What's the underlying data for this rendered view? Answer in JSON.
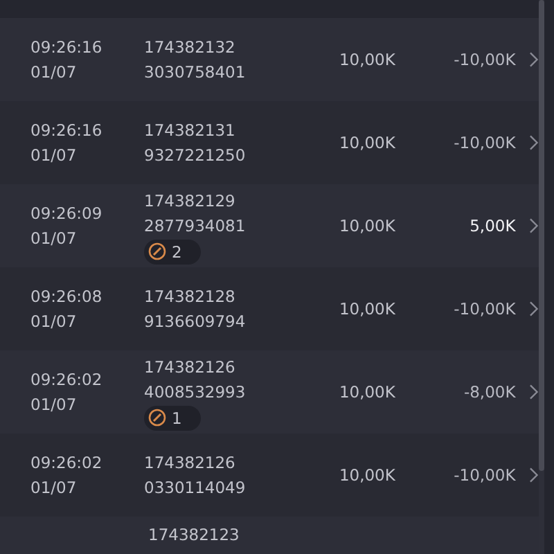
{
  "rows": [
    {
      "time": "09:26:16",
      "date": "01/07",
      "id_line_1": "174382132",
      "id_line_2": "3030758401",
      "amount": "10,00K",
      "result": "-10,00K",
      "kind": "loss"
    },
    {
      "time": "09:26:16",
      "date": "01/07",
      "id_line_1": "174382131",
      "id_line_2": "9327221250",
      "amount": "10,00K",
      "result": "-10,00K",
      "kind": "loss"
    },
    {
      "time": "09:26:09",
      "date": "01/07",
      "id_line_1": "174382129",
      "id_line_2": "2877934081",
      "badge_count": "2",
      "amount": "10,00K",
      "result": "5,00K",
      "kind": "win"
    },
    {
      "time": "09:26:08",
      "date": "01/07",
      "id_line_1": "174382128",
      "id_line_2": "9136609794",
      "amount": "10,00K",
      "result": "-10,00K",
      "kind": "loss"
    },
    {
      "time": "09:26:02",
      "date": "01/07",
      "id_line_1": "174382126",
      "id_line_2": "4008532993",
      "badge_count": "1",
      "amount": "10,00K",
      "result": "-8,00K",
      "kind": "loss"
    },
    {
      "time": "09:26:02",
      "date": "01/07",
      "id_line_1": "174382126",
      "id_line_2": "0330114049",
      "amount": "10,00K",
      "result": "-10,00K",
      "kind": "loss"
    }
  ],
  "partial_row": {
    "id_line_1": "174382123"
  }
}
